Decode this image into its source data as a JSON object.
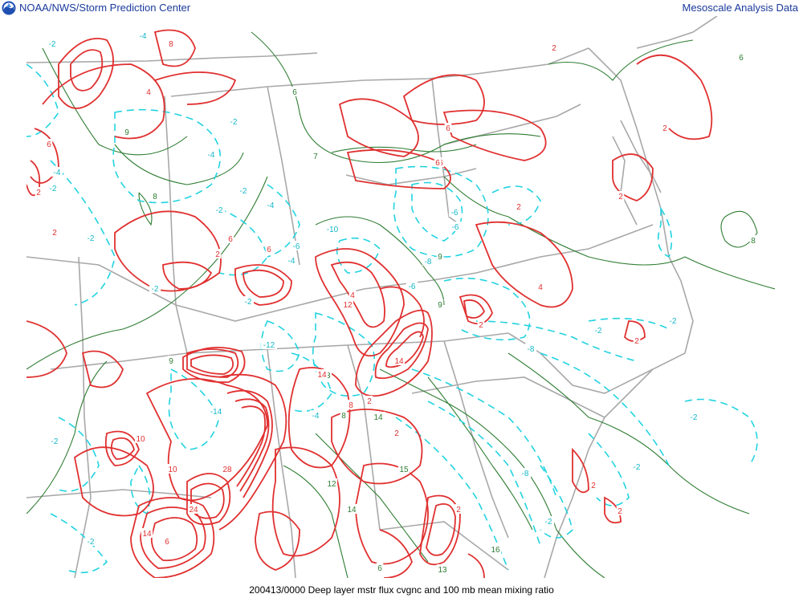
{
  "header": {
    "org_label": "NOAA/NWS/Storm Prediction Center",
    "product_label": "Mesoscale Analysis Data",
    "logo_icon": "noaa-logo-icon"
  },
  "caption": "200413/0000 Deep layer mstr flux cvgnc and 100 mb mean mixing ratio",
  "colors": {
    "convergence": "#e03030",
    "divergence": "#22d3e0",
    "mixing_ratio": "#2e7d32",
    "boundaries": "#a8a8a8",
    "title_text": "#1a3a9c"
  },
  "map": {
    "labels": {
      "mixing_ratio": [
        "9",
        "6",
        "6",
        "8",
        "8",
        "7",
        "9",
        "8",
        "9",
        "9",
        "13",
        "12",
        "13",
        "15",
        "14",
        "14",
        "16",
        "13",
        "8",
        "6"
      ],
      "convergence": [
        "2",
        "4",
        "6",
        "2",
        "2",
        "6",
        "8",
        "6",
        "2",
        "4",
        "2",
        "2",
        "4",
        "6",
        "4",
        "8",
        "10",
        "14",
        "28",
        "24",
        "14",
        "10",
        "6",
        "14",
        "12",
        "6",
        "2",
        "6",
        "2",
        "2",
        "2",
        "2",
        "2",
        "2",
        "2"
      ],
      "divergence": [
        "-2",
        "-4",
        "-2",
        "-4",
        "-2",
        "-4",
        "-6",
        "-2",
        "-4",
        "-10",
        "-6",
        "-4",
        "-2",
        "-8",
        "-2",
        "-6",
        "-8",
        "-2",
        "-14",
        "-12",
        "-8",
        "-2",
        "-2",
        "-2",
        "-6",
        "-4",
        "-2",
        "-2",
        "-2",
        "-2",
        "-2"
      ]
    }
  }
}
